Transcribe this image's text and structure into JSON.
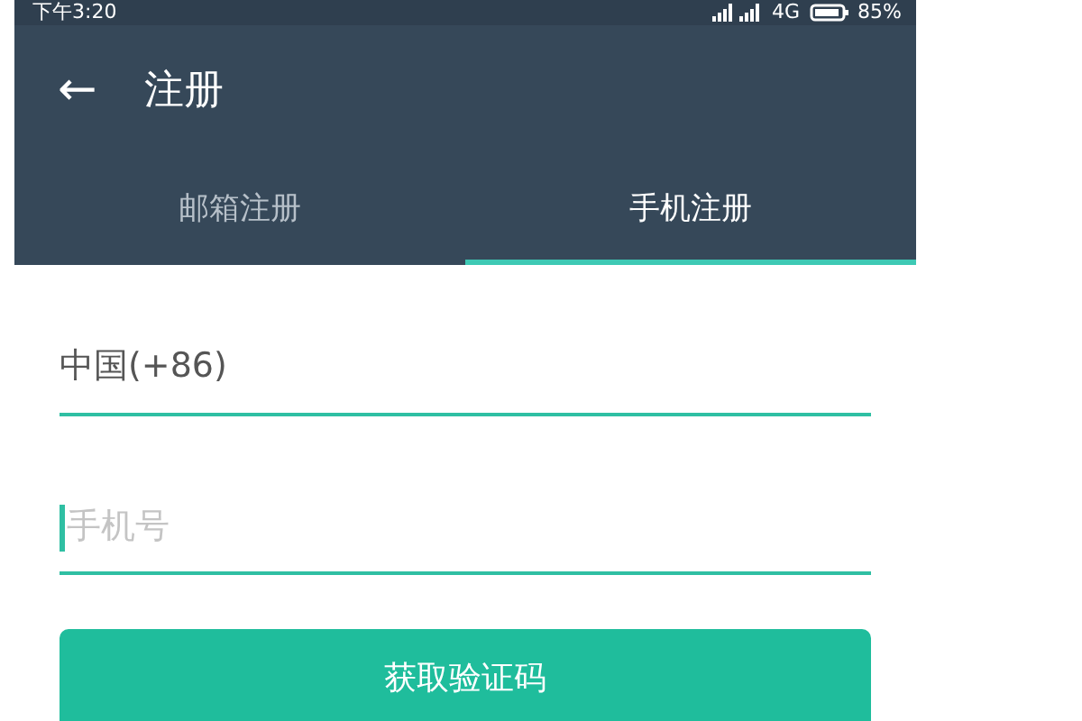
{
  "status_bar": {
    "time": "下午3:20",
    "network": "4G",
    "battery": "85%"
  },
  "toolbar": {
    "back": "←",
    "title": "注册"
  },
  "tabs": [
    {
      "label": "邮箱注册",
      "selected": false
    },
    {
      "label": "手机注册",
      "selected": true
    }
  ],
  "form": {
    "country": {
      "value": "中国(+86)"
    },
    "phone": {
      "placeholder": "手机号",
      "focused": true
    },
    "submit": "获取验证码"
  }
}
